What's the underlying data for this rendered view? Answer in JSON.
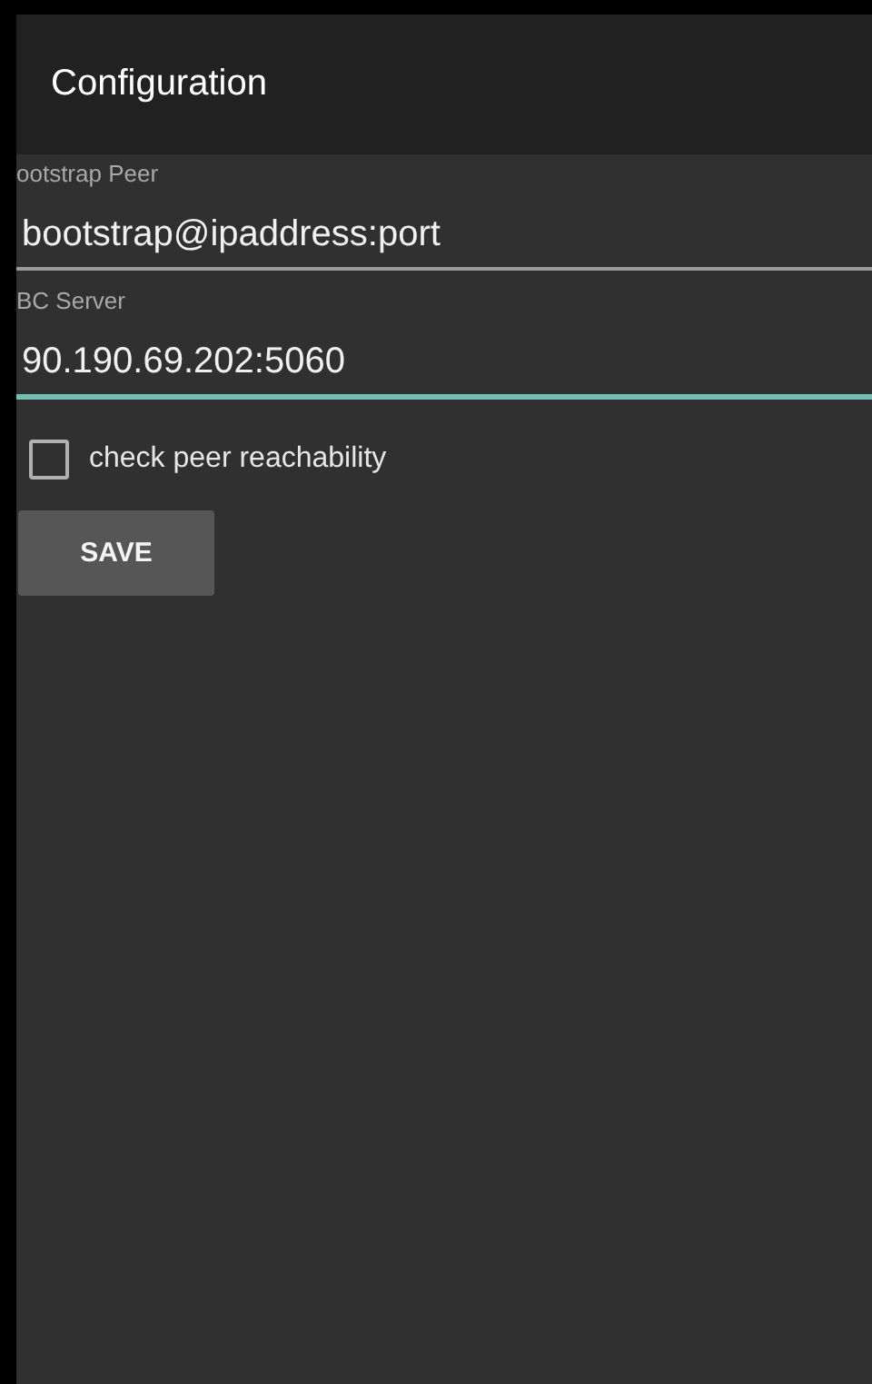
{
  "app_bar": {
    "title": "Configuration"
  },
  "fields": [
    {
      "label": "ootstrap Peer",
      "value": "bootstrap@ipaddress:port",
      "focused": false
    },
    {
      "label": "BC Server",
      "value": "90.190.69.202:5060",
      "focused": true
    }
  ],
  "checkbox": {
    "label": "check peer reachability",
    "checked": false
  },
  "buttons": [
    "SAVE"
  ]
}
